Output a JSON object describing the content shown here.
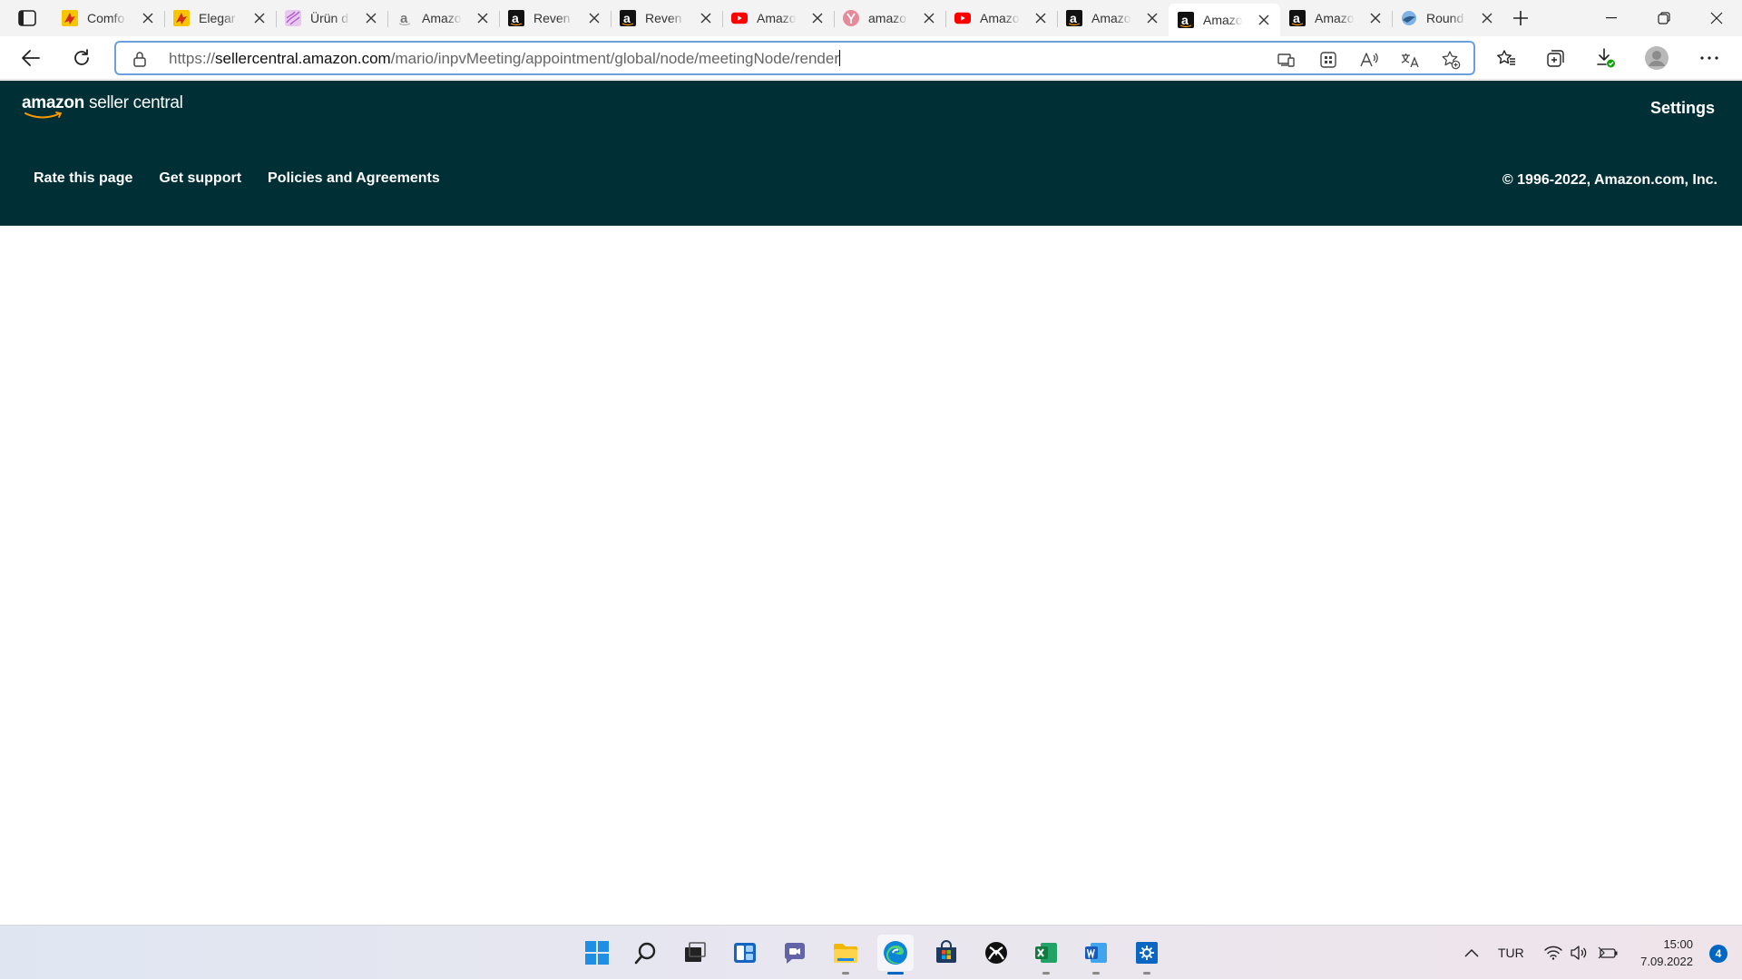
{
  "browser": {
    "tabs": [
      {
        "title": "Comfo",
        "favicon": "flyer-icon",
        "active": false
      },
      {
        "title": "Elegar",
        "favicon": "flyer-icon",
        "active": false
      },
      {
        "title": "Ürün d",
        "favicon": "purple-pattern-icon",
        "active": false
      },
      {
        "title": "Amazo",
        "favicon": "amazon-gray-icon",
        "active": false
      },
      {
        "title": "Reven",
        "favicon": "amazon-icon",
        "active": false
      },
      {
        "title": "Reven",
        "favicon": "amazon-icon",
        "active": false
      },
      {
        "title": "Amazo",
        "favicon": "youtube-icon",
        "active": false
      },
      {
        "title": "amazo",
        "favicon": "y-pink-icon",
        "active": false
      },
      {
        "title": "Amazo",
        "favicon": "youtube-icon",
        "active": false
      },
      {
        "title": "Amazo",
        "favicon": "amazon-icon",
        "active": false
      },
      {
        "title": "Amazo",
        "favicon": "amazon-icon",
        "active": true
      },
      {
        "title": "Amazo",
        "favicon": "amazon-icon",
        "active": false
      },
      {
        "title": "Round",
        "favicon": "globe-bird-icon",
        "active": false
      }
    ],
    "address": {
      "scheme": "https://",
      "host": "sellercentral.amazon.com",
      "path": "/mario/inpvMeeting/appointment/global/node/meetingNode/render"
    }
  },
  "page": {
    "logo_word1": "amazon",
    "logo_word2": "seller central",
    "settings_label": "Settings",
    "footer_links": [
      "Rate this page",
      "Get support",
      "Policies and Agreements"
    ],
    "copyright": "© 1996-2022, Amazon.com, Inc."
  },
  "taskbar": {
    "apps": [
      "windows-start-icon",
      "search-icon",
      "task-view-icon",
      "widgets-icon",
      "teams-chat-icon",
      "file-explorer-icon",
      "edge-icon",
      "store-icon",
      "xbox-icon",
      "excel-icon",
      "word-icon",
      "settings-icon"
    ],
    "language": "TUR",
    "time": "15:00",
    "date": "7.09.2022",
    "notification_count": "4"
  },
  "colors": {
    "header_bg": "#002f36",
    "accent": "#0067c0",
    "address_focus": "#6b9fde"
  }
}
